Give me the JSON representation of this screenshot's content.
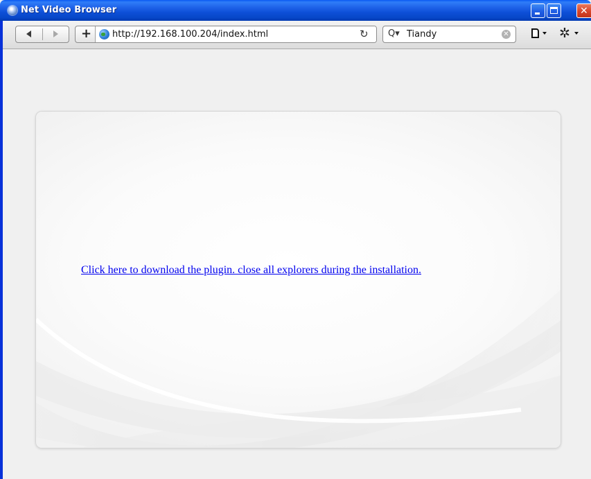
{
  "window": {
    "title": "Net Video Browser"
  },
  "toolbar": {
    "url": "http://192.168.100.204/index.html",
    "search_value": "Tiandy"
  },
  "page": {
    "link_text": "Click here to download the plugin. close all explorers during the installation."
  },
  "icons": {
    "app": "app-globe-icon",
    "back": "back-arrow-icon",
    "forward": "forward-arrow-icon",
    "add": "plus-icon",
    "site": "globe-icon",
    "reload": "reload-icon",
    "search": "search-icon",
    "clear": "clear-icon",
    "page_menu": "page-icon",
    "tools_menu": "gear-icon"
  },
  "colors": {
    "titlebar": "#0a4fd7",
    "link": "#0000ee",
    "close_button": "#d8452a"
  }
}
